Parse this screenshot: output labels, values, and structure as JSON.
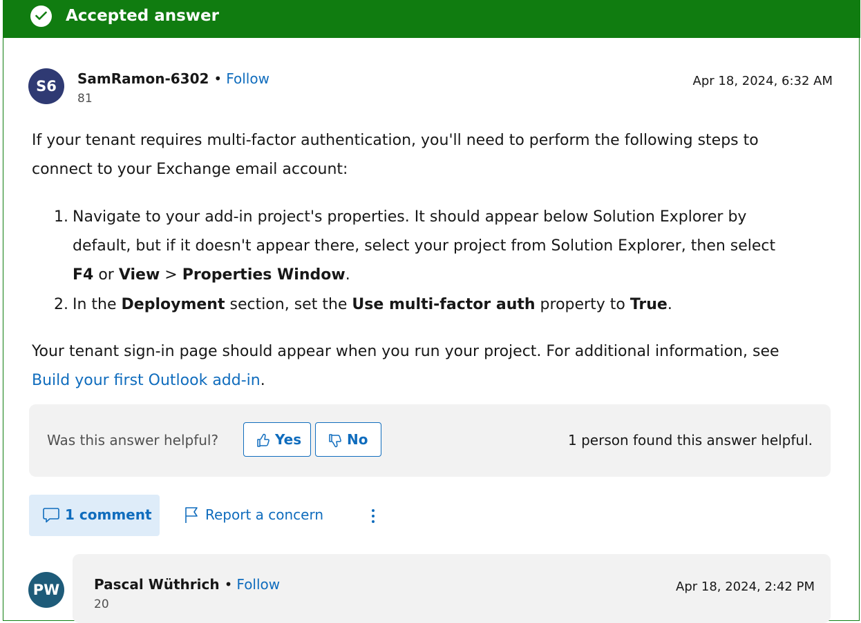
{
  "banner": {
    "title": "Accepted answer",
    "icon": "checkmark-icon",
    "color": "#107c10"
  },
  "answer": {
    "avatar_initials": "S6",
    "author": "SamRamon-6302",
    "separator": "•",
    "follow_label": "Follow",
    "reputation": "81",
    "date": "Apr 18, 2024, 6:32 AM",
    "intro_line1": "If your tenant requires multi-factor authentication, you'll need to perform the following steps to",
    "intro_line2": "connect to your Exchange email account:",
    "step1": {
      "num": "1.",
      "line1": "Navigate to your add-in project's properties. It should appear below Solution Explorer by",
      "line2": "default, but if it doesn't appear there, select your project from Solution Explorer, then select",
      "f4": "F4",
      "or": " or ",
      "view": "View",
      "gt": " > ",
      "props": "Properties Window",
      "end": "."
    },
    "step2": {
      "num": "2.",
      "a": "In the ",
      "deployment": "Deployment",
      "b": " section, set the ",
      "mfa": "Use multi-factor auth",
      "c": " property to ",
      "true": "True",
      "d": "."
    },
    "outro_line1": "Your tenant sign-in page should appear when you run your project. For additional information, see",
    "outro_link": "Build your first Outlook add-in",
    "outro_end": "."
  },
  "helpful": {
    "question": "Was this answer helpful?",
    "yes_label": "Yes",
    "no_label": "No",
    "count_text": "1 person found this answer helpful."
  },
  "actions": {
    "comment_label": "1 comment",
    "report_label": "Report a concern"
  },
  "comment": {
    "avatar_initials": "PW",
    "author": "Pascal Wüthrich",
    "separator": "•",
    "follow_label": "Follow",
    "reputation": "20",
    "date": "Apr 18, 2024, 2:42 PM"
  }
}
